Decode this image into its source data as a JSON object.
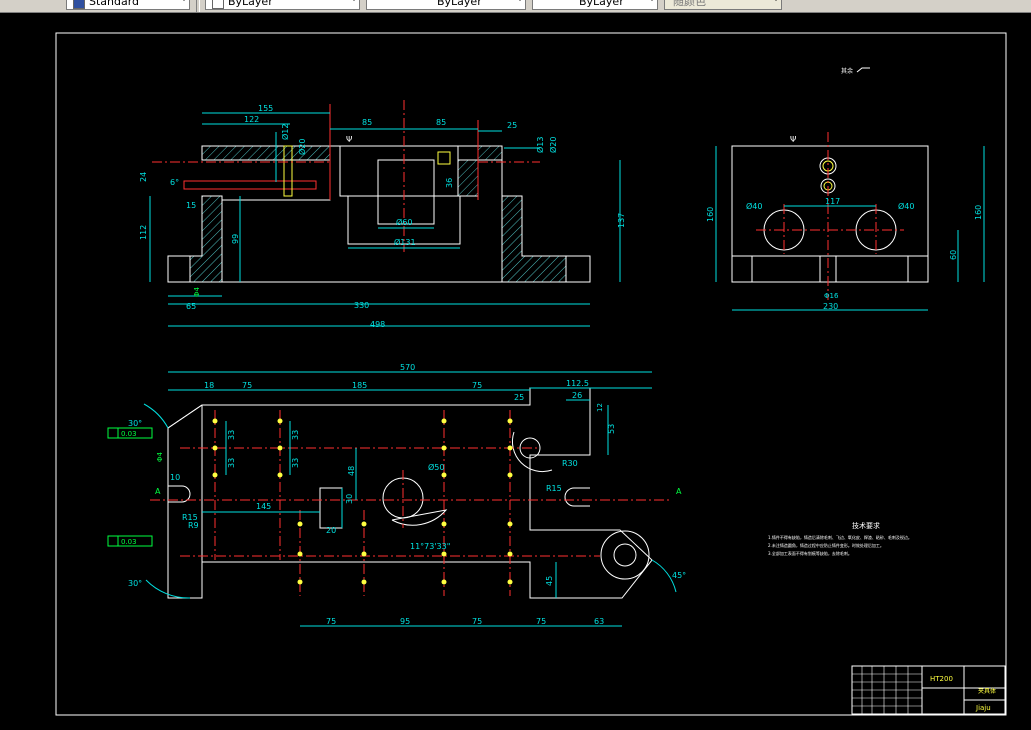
{
  "toolbar": {
    "text_style": "Standard",
    "layer_color": "ByLayer",
    "linetype": "ByLayer",
    "lineweight": "ByLayer",
    "plot_style": "随颜色"
  },
  "drawing": {
    "top_note": "其余",
    "front": {
      "dims": [
        "155",
        "122",
        "85",
        "85",
        "25",
        "Ø12",
        "Ø20",
        "Ø13",
        "Ø20",
        "24",
        "6°",
        "15",
        "112",
        "99",
        "36",
        "Ø60",
        "Ø131",
        "137",
        "65",
        "330",
        "498",
        "Φ4"
      ]
    },
    "side": {
      "dims": [
        "160",
        "Ø40",
        "117",
        "Ø40",
        "160",
        "60",
        "Φ16",
        "230"
      ]
    },
    "plan": {
      "dims": [
        "570",
        "18",
        "75",
        "185",
        "75",
        "112.5",
        "25",
        "26",
        "12",
        "53",
        "33",
        "33",
        "33",
        "33",
        "48",
        "Ø50",
        "R30",
        "10",
        "R15",
        "R15",
        "R9",
        "145",
        "30",
        "20",
        "11°73'33\"",
        "45",
        "30°",
        "30°",
        "45°",
        "75",
        "95",
        "75",
        "75",
        "63",
        "Φ4",
        "0.03",
        "0.03"
      ]
    },
    "notes": {
      "title": "技术要求",
      "lines": [
        "1.铸件不得有缺陷，铸造后清除毛刺、飞边、氧化皮、焊渣、粘砂、毛刺及锐边。",
        "2.未注铸造圆角，铸造过程中应防止铸件变形。时效处理后加工。",
        "3.全部加工表面不得有划痕等缺陷，去除毛刺。"
      ]
    },
    "title_block": {
      "material": "HT200",
      "part_name": "夹具体",
      "drawing_no": "Jiaju"
    }
  }
}
